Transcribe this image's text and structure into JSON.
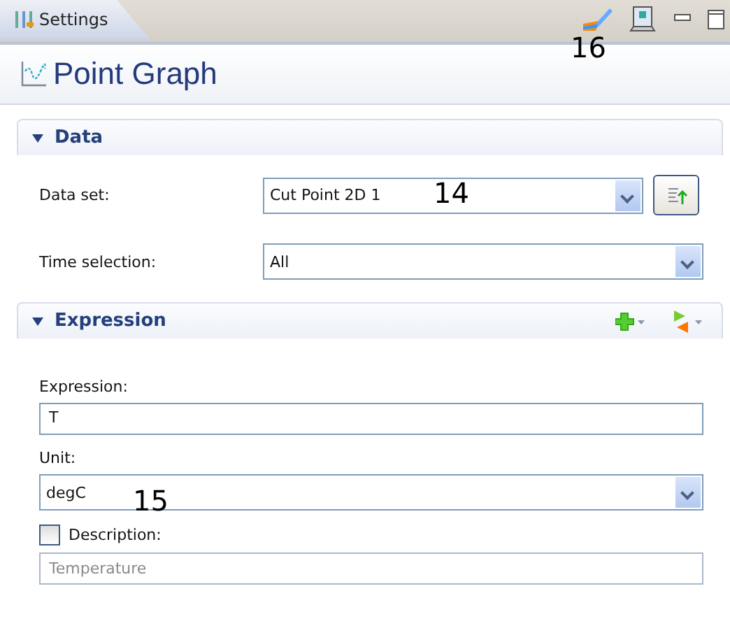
{
  "tab": {
    "label": "Settings",
    "selected": true
  },
  "title": "Point Graph",
  "sections": [
    {
      "title": "Data",
      "expanded": true,
      "kind": "data",
      "rows": [
        {
          "kind": "combo_action",
          "label": "Data set:",
          "value": "Cut Point 2D 1"
        },
        {
          "kind": "combo",
          "label": "Time selection:",
          "value": "All"
        }
      ]
    },
    {
      "title": "Expression",
      "expanded": true,
      "kind": "expression",
      "rows": [
        {
          "kind": "text",
          "label": "Expression:",
          "value": "T"
        },
        {
          "kind": "combo",
          "label": "Unit:",
          "value": "degC"
        },
        {
          "kind": "checkfield",
          "label": "Description:",
          "checked": false,
          "placeholder": "Temperature"
        }
      ]
    }
  ],
  "callouts": [
    {
      "text": "16",
      "kind": "toolbar"
    },
    {
      "text": "14",
      "kind": "dataset"
    },
    {
      "text": "15",
      "kind": "unit"
    }
  ]
}
